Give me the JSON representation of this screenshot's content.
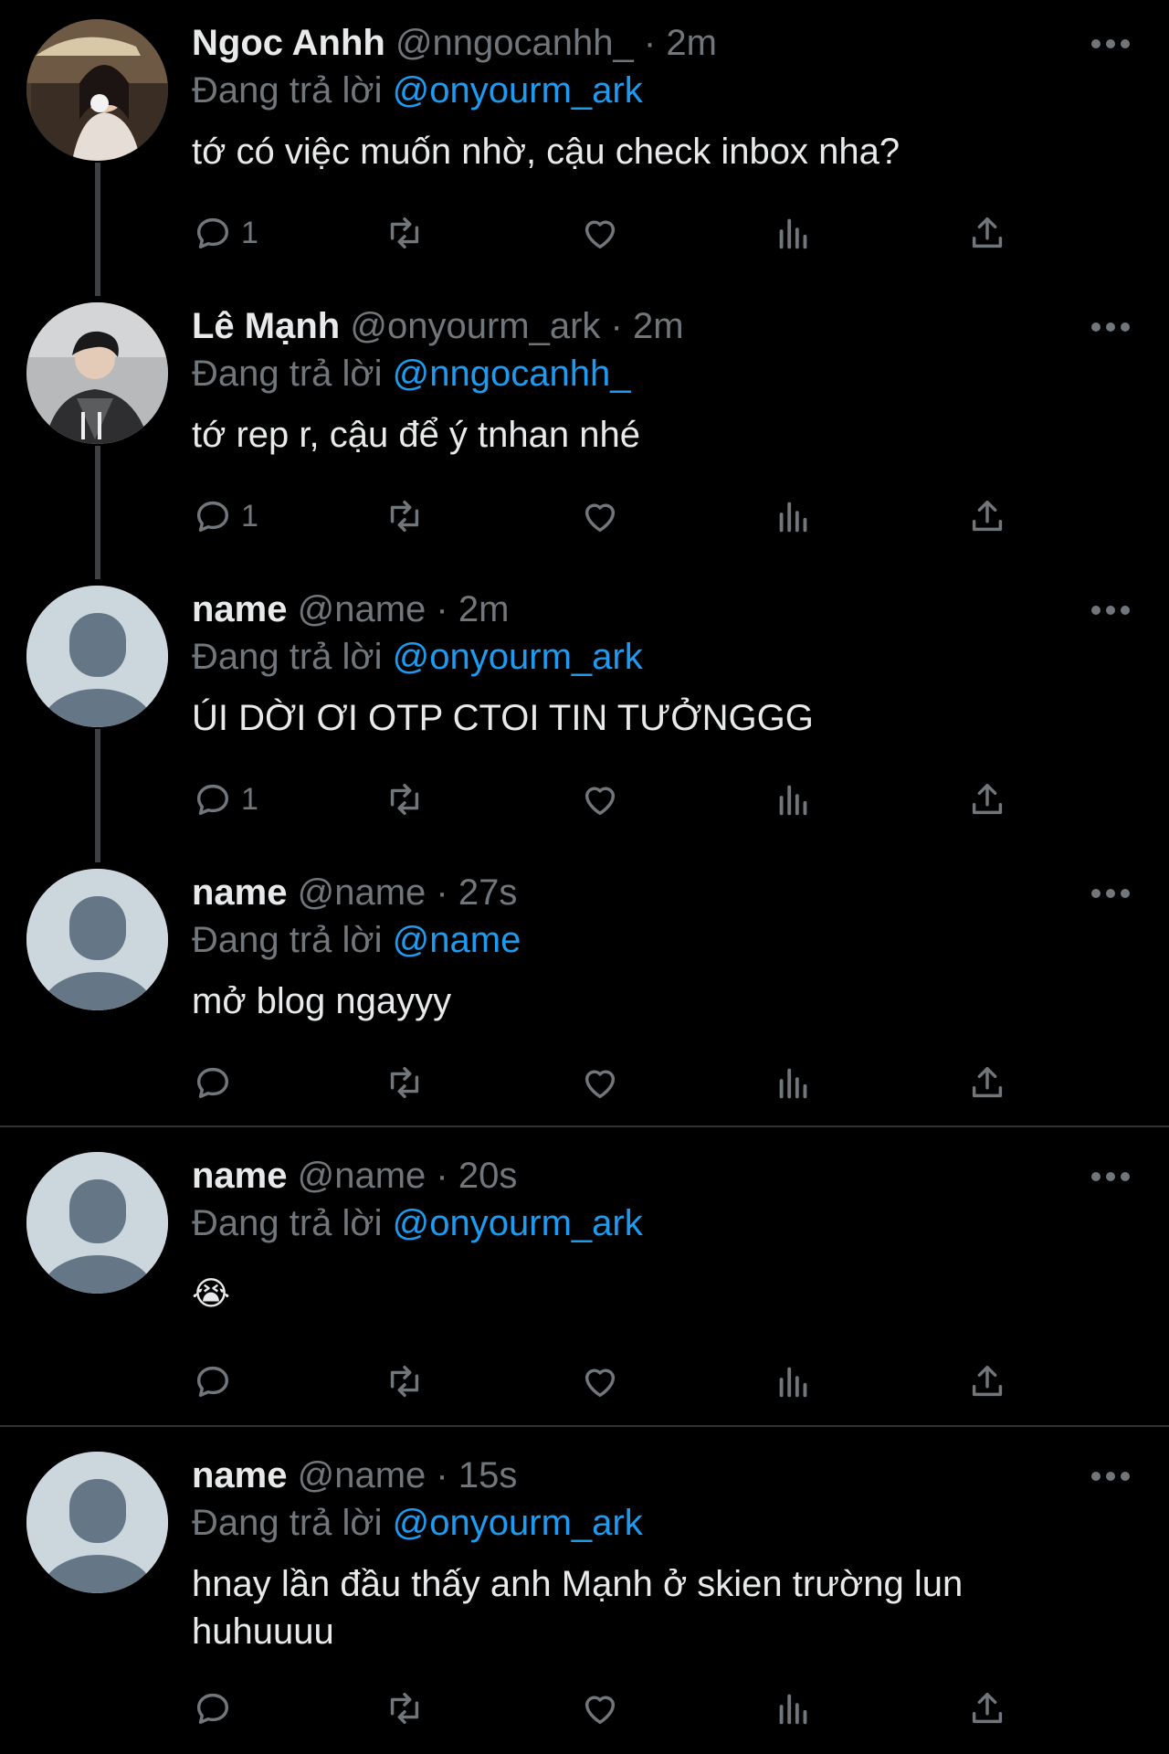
{
  "labels": {
    "replying_to": "Đang trả lời"
  },
  "colors": {
    "background": "#000000",
    "text": "#e7e9ea",
    "muted": "#71767b",
    "accent": "#1d9bf0",
    "divider": "#2f3336"
  },
  "tweets": [
    {
      "name": "Ngoc Anhh",
      "handle": "@nngocanhh_",
      "time": "2m",
      "reply_to": "@onyourm_ark",
      "text": "tớ có việc muốn nhờ, cậu check inbox nha?",
      "reply_count": "1",
      "avatar": "photo-avatar-girl"
    },
    {
      "name": "Lê Mạnh",
      "handle": "@onyourm_ark",
      "time": "2m",
      "reply_to": "@nngocanhh_",
      "text": "tớ rep r, cậu để ý tnhan nhé",
      "reply_count": "1",
      "avatar": "photo-avatar-boy"
    },
    {
      "name": "name",
      "handle": "@name",
      "time": "2m",
      "reply_to": "@onyourm_ark",
      "text": "ÚI DỜI ƠI OTP CTOI TIN TƯỞNGGG",
      "reply_count": "1",
      "avatar": "default-avatar"
    },
    {
      "name": "name",
      "handle": "@name",
      "time": "27s",
      "reply_to": "@name",
      "text": "mở blog ngayyy",
      "reply_count": "",
      "avatar": "default-avatar"
    },
    {
      "name": "name",
      "handle": "@name",
      "time": "20s",
      "reply_to": "@onyourm_ark",
      "text": "😭",
      "reply_count": "",
      "avatar": "default-avatar"
    },
    {
      "name": "name",
      "handle": "@name",
      "time": "15s",
      "reply_to": "@onyourm_ark",
      "text": "hnay lần đầu thấy anh Mạnh ở skien trường lun huhuuuu",
      "reply_count": "",
      "avatar": "default-avatar"
    }
  ],
  "icons": {
    "reply": "reply-icon",
    "retweet": "retweet-icon",
    "like": "heart-icon",
    "views": "views-chart-icon",
    "share": "share-icon",
    "more": "more-icon"
  }
}
